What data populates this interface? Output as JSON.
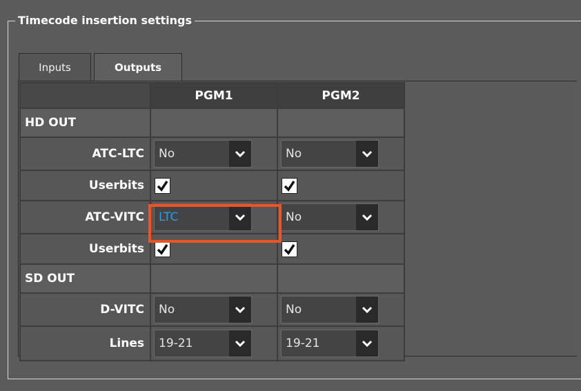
{
  "group_title": "Timecode insertion settings",
  "tabs": [
    {
      "label": "Inputs",
      "active": false
    },
    {
      "label": "Outputs",
      "active": true
    }
  ],
  "columns": [
    "",
    "PGM1",
    "PGM2"
  ],
  "sections": {
    "hd_out": "HD OUT",
    "sd_out": "SD OUT"
  },
  "rows": {
    "atc_ltc": {
      "label": "ATC-LTC",
      "pgm1": "No",
      "pgm2": "No"
    },
    "atc_ltc_userbits": {
      "label": "Userbits",
      "pgm1": true,
      "pgm2": true
    },
    "atc_vitc": {
      "label": "ATC-VITC",
      "pgm1": "LTC",
      "pgm2": "No"
    },
    "atc_vitc_userbits": {
      "label": "Userbits",
      "pgm1": true,
      "pgm2": true
    },
    "d_vitc": {
      "label": "D-VITC",
      "pgm1": "No",
      "pgm2": "No"
    },
    "lines": {
      "label": "Lines",
      "pgm1": "19-21",
      "pgm2": "19-21"
    }
  },
  "colors": {
    "highlight": "#f4531f",
    "selected_value": "#2f9be0"
  },
  "icons": {
    "dropdown": "chevron-down-icon",
    "checkbox": "checkmark-icon"
  }
}
